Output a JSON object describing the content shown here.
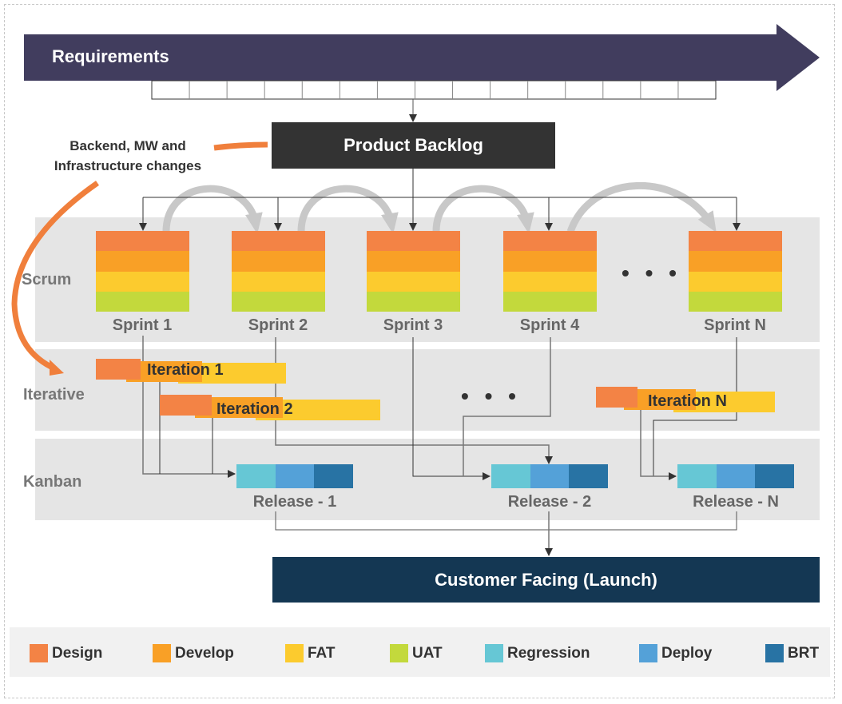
{
  "requirements": {
    "label": "Requirements",
    "color": "#413d5e",
    "slots": 15
  },
  "product_backlog": {
    "label": "Product Backlog",
    "color": "#333333"
  },
  "note": {
    "line1": "Backend, MW and",
    "line2": "Infrastructure changes",
    "arrow_color": "#f07f3c"
  },
  "lanes": {
    "scrum": "Scrum",
    "iterative": "Iterative",
    "kanban": "Kanban"
  },
  "sprints": [
    {
      "label": "Sprint 1"
    },
    {
      "label": "Sprint 2"
    },
    {
      "label": "Sprint 3"
    },
    {
      "label": "Sprint 4"
    },
    {
      "label": "Sprint N"
    }
  ],
  "ellipsis": "• • •",
  "iterations": [
    {
      "label": "Iteration 1"
    },
    {
      "label": "Iteration 2"
    },
    {
      "label": "Iteration N"
    }
  ],
  "releases": [
    {
      "label": "Release - 1"
    },
    {
      "label": "Release - 2"
    },
    {
      "label": "Release - N"
    }
  ],
  "launch": {
    "label": "Customer Facing (Launch)",
    "color": "#143753"
  },
  "colors": {
    "design": "#f38345",
    "develop": "#f9a026",
    "fat": "#fccb2e",
    "uat": "#c3d93c",
    "regression": "#66c7d5",
    "deploy": "#54a1d8",
    "brt": "#2873a4"
  },
  "legend": [
    {
      "label": "Design",
      "color": "#f38345"
    },
    {
      "label": "Develop",
      "color": "#f9a026"
    },
    {
      "label": "FAT",
      "color": "#fccb2e"
    },
    {
      "label": "UAT",
      "color": "#c3d93c"
    },
    {
      "label": "Regression",
      "color": "#66c7d5"
    },
    {
      "label": "Deploy",
      "color": "#54a1d8"
    },
    {
      "label": "BRT",
      "color": "#2873a4"
    }
  ]
}
